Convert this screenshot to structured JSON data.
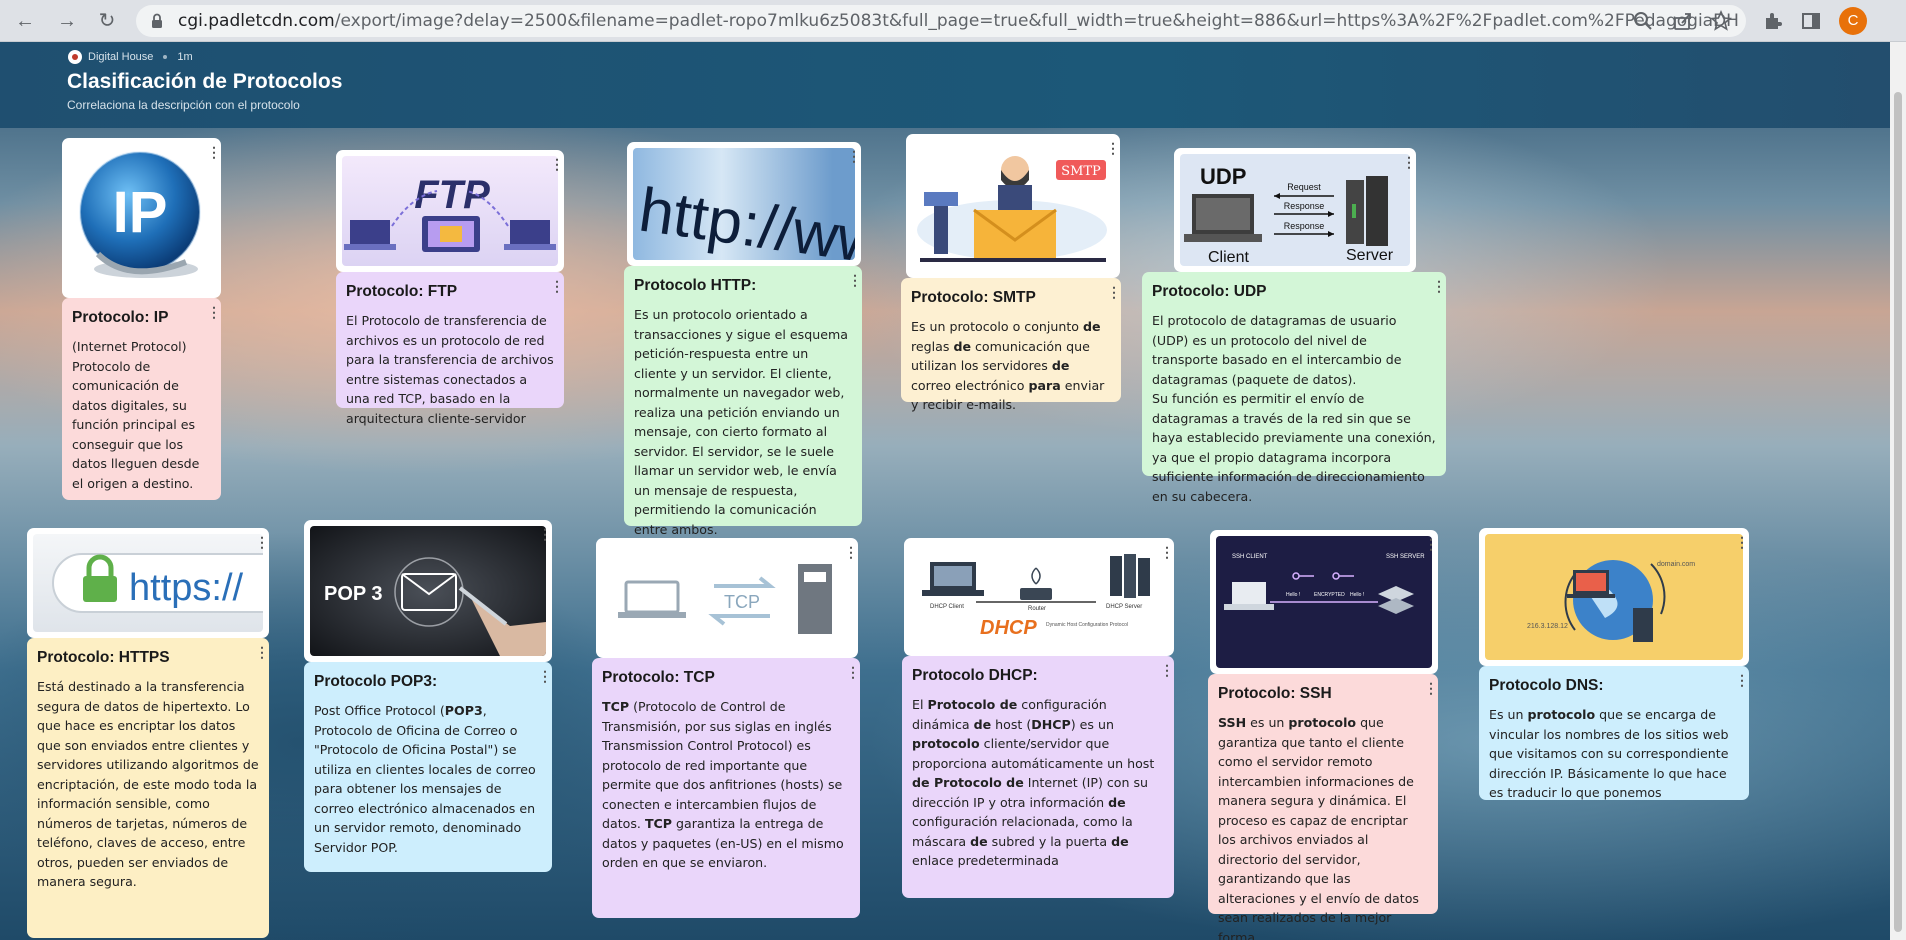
{
  "browser": {
    "url_host": "cgi.padletcdn.com",
    "url_path": "/export/image?delay=2500&filename=padlet-ropo7mlku6z5083t&full_page=true&full_width=true&height=886&url=https%3A%2F%2Fpadlet.com%2FPedagogiaDH...",
    "profile_initial": "C"
  },
  "header": {
    "author": "Digital House",
    "time": "1m",
    "title": "Clasificación de Protocolos",
    "subtitle": "Correlaciona la descripción con el protocolo"
  },
  "images": {
    "ip": "IP",
    "ftp": "FTP",
    "http": "http://ww",
    "smtp": "SMTP",
    "udp_title": "UDP",
    "udp_request": "Request",
    "udp_response": "Response",
    "udp_client": "Client",
    "udp_server": "Server",
    "https": "https://",
    "pop3": "POP 3",
    "tcp": "TCP",
    "dhcp_client": "DHCP Client",
    "dhcp_router": "Router",
    "dhcp_server": "DHCP Server",
    "dhcp_logo": "DHCP",
    "dhcp_caption": "Dynamic Host Configuration Protocol",
    "ssh_client": "SSH CLIENT",
    "ssh_server": "SSH SERVER",
    "ssh_hello1": "Hello !",
    "ssh_hello2": "Hello !",
    "ssh_enc": "ENCRYPTED",
    "dns_domain": "domain.com",
    "dns_ip": "216.3.128.12"
  },
  "cards": {
    "ip": {
      "title": "Protocolo: IP",
      "body": "(Internet Protocol) Protocolo de comunicación de datos digitales, su función principal es conseguir que los datos lleguen desde el origen a destino."
    },
    "ftp": {
      "title": "Protocolo: FTP",
      "body": "El Protocolo de transferencia de archivos es un protocolo de red para la transferencia de archivos entre sistemas conectados a una red TCP, basado en la arquitectura cliente-servidor"
    },
    "http": {
      "title": "Protocolo HTTP:",
      "body": "Es un protocolo orientado a transacciones y sigue el esquema petición-respuesta entre un cliente y un servidor. El cliente, normalmente un navegador web, realiza una petición enviando un mensaje, con cierto formato al servidor. El servidor, se le suele llamar un servidor web, le envía un mensaje de respuesta, permitiendo la comunicación entre ambos."
    },
    "smtp": {
      "title": "Protocolo: SMTP",
      "body_1": "Es un protocolo o conjunto ",
      "b1": "de",
      "body_2": " reglas ",
      "b2": "de",
      "body_3": " comunicación que utilizan los servidores ",
      "b3": "de",
      "body_4": " correo electrónico ",
      "b4": "para",
      "body_5": " enviar y recibir e-mails."
    },
    "udp": {
      "title": "Protocolo: UDP",
      "body": "El protocolo de datagramas de usuario (UDP) es un protocolo del nivel de transporte basado en el intercambio de datagramas (paquete de datos).",
      "body2": "Su función es permitir el envío de datagramas a través de la red sin que se haya establecido previamente una conexión, ya que el propio datagrama incorpora suficiente información de direccionamiento en su cabecera."
    },
    "https": {
      "title": "Protocolo: HTTPS",
      "body": "Está destinado a la transferencia segura de datos de hipertexto. Lo que hace es encriptar los datos que son enviados entre clientes y servidores utilizando algoritmos de encriptación, de este modo toda la información sensible, como números de tarjetas, números de teléfono, claves de acceso, entre otros, pueden ser enviados de manera segura."
    },
    "pop3": {
      "title": "Protocolo POP3:",
      "body_1": "Post Office Protocol (",
      "b1": "POP3",
      "body_2": ", Protocolo de Oficina de Correo o \"Protocolo de Oficina Postal\") se utiliza en clientes locales de correo para obtener los mensajes de correo electrónico almacenados en un servidor remoto, denominado Servidor POP."
    },
    "tcp": {
      "title": "Protocolo: TCP",
      "b1": "TCP",
      "body_1": " (Protocolo de Control de Transmisión, por sus siglas en inglés Transmission Control Protocol) es protocolo de red importante que permite que dos anfitriones (hosts) se conecten e intercambien flujos de datos. ",
      "b2": "TCP",
      "body_2": " garantiza la entrega de datos y paquetes (en-US) en el mismo orden en que se enviaron."
    },
    "dhcp": {
      "title": "Protocolo DHCP:",
      "body_1": "El ",
      "b1": "Protocolo de",
      "body_2": " configuración dinámica ",
      "b2": "de",
      "body_3": " host (",
      "b3": "DHCP",
      "body_4": ") es un ",
      "b4": "protocolo",
      "body_5": " cliente/servidor que proporciona automáticamente un host ",
      "b5": "de Protocolo de",
      "body_6": " Internet (IP) con su dirección IP y otra información ",
      "b6": "de",
      "body_7": " configuración relacionada, como la máscara ",
      "b7": "de",
      "body_8": " subred y la puerta ",
      "b8": "de",
      "body_9": " enlace predeterminada"
    },
    "ssh": {
      "title": "Protocolo: SSH",
      "b1": "SSH",
      "body_1": " es un ",
      "b2": "protocolo",
      "body_2": " que garantiza que tanto el cliente como el servidor remoto intercambien informaciones de manera segura y dinámica. El proceso es capaz de encriptar los archivos enviados al directorio del servidor, garantizando que las alteraciones y el envío de datos sean realizados de la mejor forma"
    },
    "dns": {
      "title": "Protocolo DNS:",
      "body_1": " Es un ",
      "b1": "protocolo",
      "body_2": " que se encarga de vincular los nombres de los sitios web que visitamos con su correspondiente dirección IP. Básicamente lo que hace es traducir lo que ponemos"
    }
  },
  "kebab_glyph": "⋮"
}
